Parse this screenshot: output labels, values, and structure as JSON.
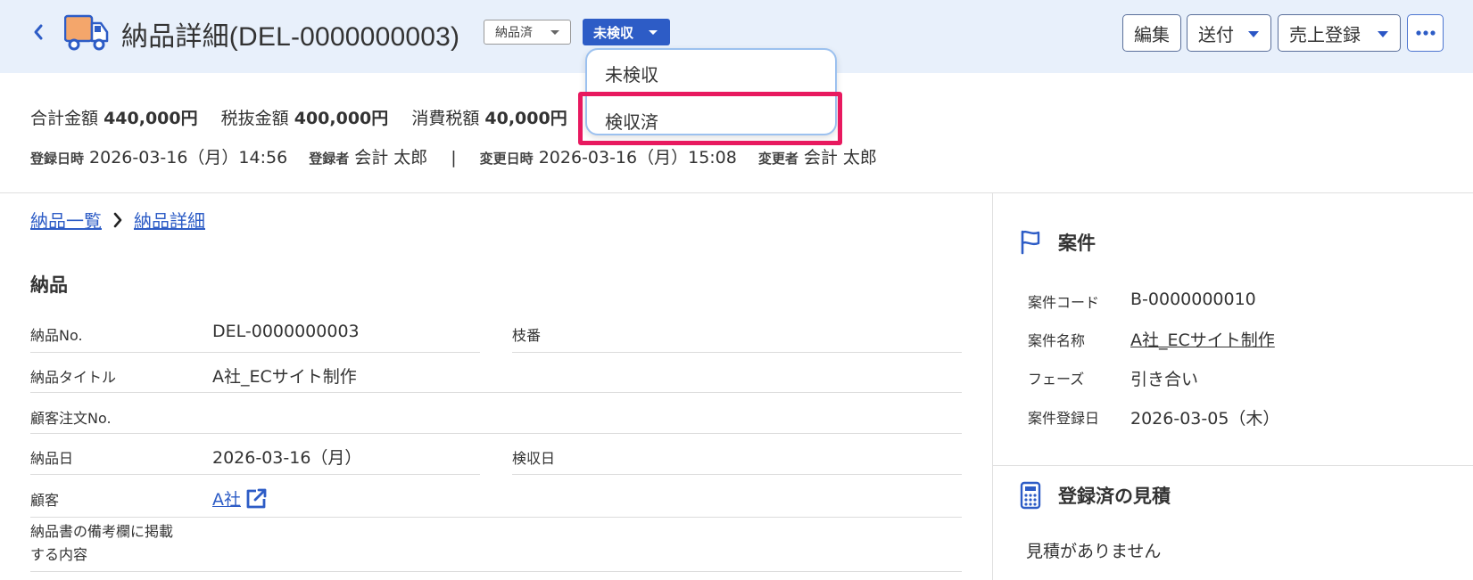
{
  "header": {
    "title": "納品詳細(DEL-0000000003)",
    "status": "納品済",
    "inspection": "未検収",
    "buttons": {
      "edit": "編集",
      "send": "送付",
      "sales": "売上登録"
    }
  },
  "dropdown": {
    "items": [
      "未検収",
      "検収済"
    ]
  },
  "summary": {
    "total_label": "合計金額",
    "total": "440,000円",
    "pretax_label": "税抜金額",
    "pretax": "400,000円",
    "tax_label": "消費税額",
    "tax": "40,000円"
  },
  "meta": {
    "created_label": "登録日時",
    "created": "2026-03-16（月）14:56",
    "creator_label": "登録者",
    "creator": "会計 太郎",
    "sep": "|",
    "updated_label": "変更日時",
    "updated": "2026-03-16（月）15:08",
    "updater_label": "変更者",
    "updater": "会計 太郎"
  },
  "breadcrumb": {
    "list": "納品一覧",
    "detail": "納品詳細"
  },
  "delivery": {
    "section_title": "納品",
    "no_label": "納品No.",
    "no": "DEL-0000000003",
    "branch_label": "枝番",
    "title_label": "納品タイトル",
    "title": "A社_ECサイト制作",
    "order_label": "顧客注文No.",
    "date_label": "納品日",
    "date": "2026-03-16（月）",
    "inspect_date_label": "検収日",
    "customer_label": "顧客",
    "customer": "A社",
    "note_label_1": "納品書の備考欄に掲載",
    "note_label_2": "する内容"
  },
  "project": {
    "title": "案件",
    "code_label": "案件コード",
    "code": "B-0000000010",
    "name_label": "案件名称",
    "name": "A社_ECサイト制作",
    "phase_label": "フェーズ",
    "phase": "引き合い",
    "date_label": "案件登録日",
    "date": "2026-03-05（木）"
  },
  "estimates": {
    "title": "登録済の見積",
    "empty": "見積がありません"
  },
  "colors": {
    "accent": "#2d5cc6",
    "header_bg": "#e8f0fb",
    "highlight": "#e8195f",
    "truck": "#f4a66b"
  }
}
